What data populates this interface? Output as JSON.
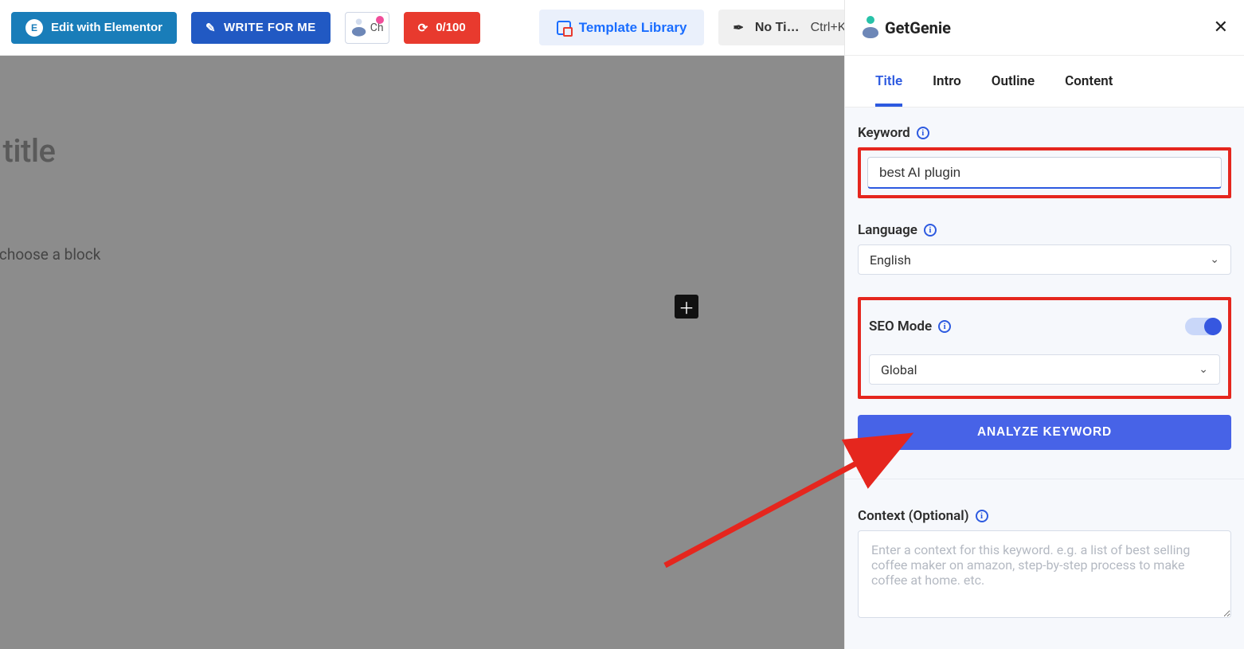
{
  "toolbar": {
    "elementor_label": "Edit with Elementor",
    "write_label": "WRITE FOR ME",
    "chip_text": "Ch",
    "score_label": "0/100",
    "template_label": "Template Library",
    "notitle_label": "No Ti…",
    "notitle_shortcut": "Ctrl+K"
  },
  "editor": {
    "title_placeholder": "dd title",
    "block_hint": "e / to choose a block"
  },
  "panel": {
    "brand": "GetGenie",
    "tabs": [
      "Title",
      "Intro",
      "Outline",
      "Content"
    ],
    "active_tab_index": 0,
    "keyword": {
      "label": "Keyword",
      "value": "best AI plugin"
    },
    "language": {
      "label": "Language",
      "value": "English"
    },
    "seo": {
      "label": "SEO Mode",
      "enabled": true,
      "scope_value": "Global"
    },
    "analyze_label": "ANALYZE KEYWORD",
    "context": {
      "label": "Context (Optional)",
      "placeholder": "Enter a context for this keyword. e.g. a list of best selling coffee maker on amazon, step-by-step process to make coffee at home. etc."
    }
  }
}
